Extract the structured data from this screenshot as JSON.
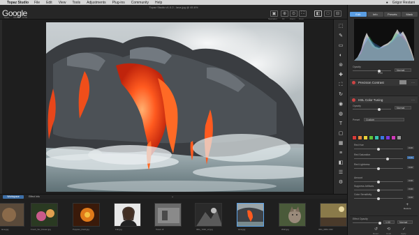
{
  "menubar": {
    "app_name": "Topaz Studio",
    "items": [
      "File",
      "Edit",
      "View",
      "Tools",
      "Adjustments",
      "Plug-ins",
      "Community",
      "Help"
    ],
    "user_name": "Grigor Restani"
  },
  "toolbar": {
    "window_title": "Topaz Studio v1.0.2 - lava.jpg @ 45.6%",
    "logo_text": "Google",
    "left_buttons": [
      "Open",
      "Save",
      "Undo"
    ],
    "right_buttons": [
      "Navigator",
      "Fit",
      "Zoom",
      "Crop"
    ]
  },
  "panel": {
    "tabs": [
      "Edit",
      "Info",
      "Presets",
      "Mask"
    ],
    "active_tab": "Edit",
    "opacity_label": "Opacity",
    "opacity_value": "1.00",
    "blend_mode": "Normal",
    "sections": [
      {
        "title": "Precision Contrast"
      },
      {
        "title": "HSL Color Tuning"
      }
    ],
    "hsl": {
      "preset_label": "Preset",
      "preset_value": "Custom",
      "swatch_colors": [
        "#d83a3a",
        "#e8843a",
        "#e8d13a",
        "#5fc43a",
        "#3ac4b2",
        "#3a78e0",
        "#7a3ae0",
        "#d03ab8",
        "#999999"
      ],
      "sliders": [
        {
          "label": "Red Hue",
          "value": "0.00",
          "level": 0.5
        },
        {
          "label": "Red Saturation",
          "value": "0.35",
          "level": 0.68
        },
        {
          "label": "Red Lightness",
          "value": "0.00",
          "level": 0.5
        }
      ],
      "overall": [
        {
          "label": "Amount",
          "value": "0.00",
          "level": 0.5
        },
        {
          "label": "Suppress Artifacts",
          "value": "0.00",
          "level": 0.5
        },
        {
          "label": "Color Sensitivity",
          "value": "0.00",
          "level": 0.5
        }
      ],
      "add_label": "Restore"
    },
    "effect_opacity_label": "Effect Opacity",
    "effect_opacity_value": "1.00",
    "effect_blend": "Normal",
    "bottom_icons": [
      "Reset",
      "Undo",
      "Apply"
    ]
  },
  "bottom": {
    "tabs": [
      "Workspace",
      "Effect Info"
    ],
    "active_tab": "Workspace",
    "thumbnails": [
      {
        "label": "lava.jpg"
      },
      {
        "label": "Fresh_Six_Flower.jpg"
      },
      {
        "label": "Poppies_Field.jpg"
      },
      {
        "label": "Fall.jpg"
      },
      {
        "label": "Totem.tif"
      },
      {
        "label": "IMG_7240_v2.jpg"
      },
      {
        "label": "lava.jpg"
      },
      {
        "label": "Wolf.jpg"
      },
      {
        "label": "IMG_0864.CR2"
      }
    ],
    "selected_index": 6
  }
}
